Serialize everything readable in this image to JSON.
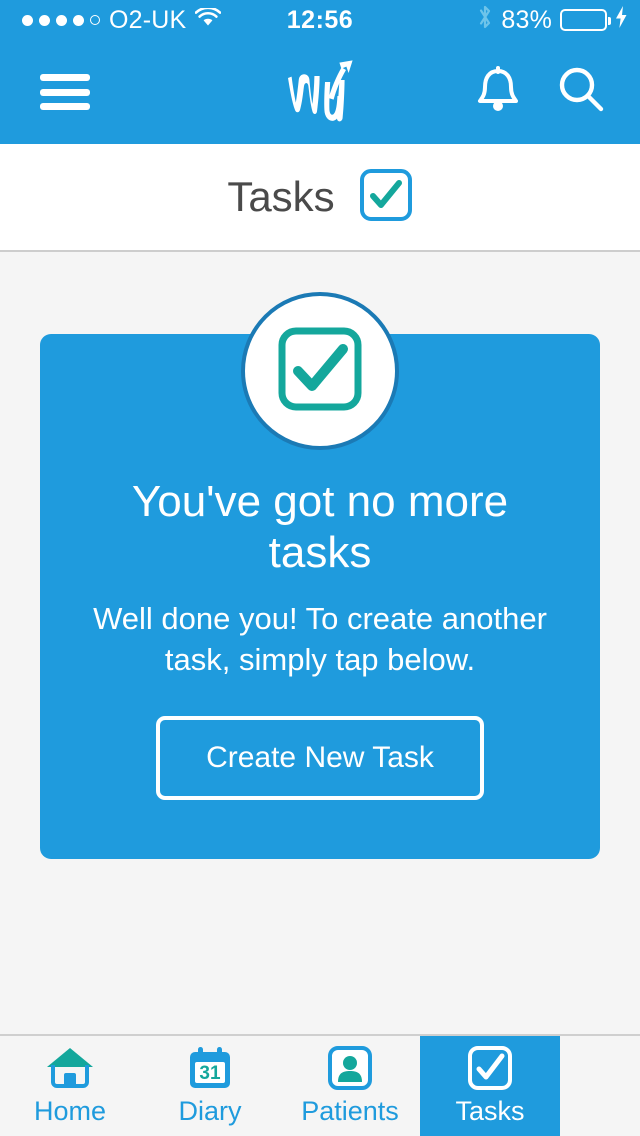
{
  "status_bar": {
    "signal_dots_filled": 4,
    "signal_dots_total": 5,
    "carrier": "O2-UK",
    "wifi_icon": "wifi-icon",
    "time": "12:56",
    "bluetooth_icon": "bluetooth-icon",
    "battery_percent": "83%",
    "battery_level": 83,
    "charging_icon": "lightning-bolt-icon",
    "battery_color": "#4cd964"
  },
  "navbar": {
    "menu_icon": "hamburger-menu-icon",
    "logo_name": "wu-brand-logo",
    "notifications_icon": "bell-icon",
    "search_icon": "search-icon",
    "background": "#1f9bdd"
  },
  "page_header": {
    "title": "Tasks",
    "icon": "checkbox-tick-icon"
  },
  "empty_state": {
    "badge_icon": "checkbox-tick-icon",
    "heading": "You've got no more tasks",
    "subtitle": "Well done you! To create another task, simply tap below.",
    "button_label": "Create New Task",
    "card_color": "#1f9bdd",
    "accent_teal": "#14a79c"
  },
  "tabbar": {
    "items": [
      {
        "label": "Home",
        "icon": "home-icon",
        "active": false
      },
      {
        "label": "Diary",
        "icon": "calendar-icon",
        "calendar_day": "31",
        "active": false
      },
      {
        "label": "Patients",
        "icon": "person-icon",
        "active": false
      },
      {
        "label": "Tasks",
        "icon": "checkbox-tick-icon",
        "active": true
      }
    ]
  }
}
